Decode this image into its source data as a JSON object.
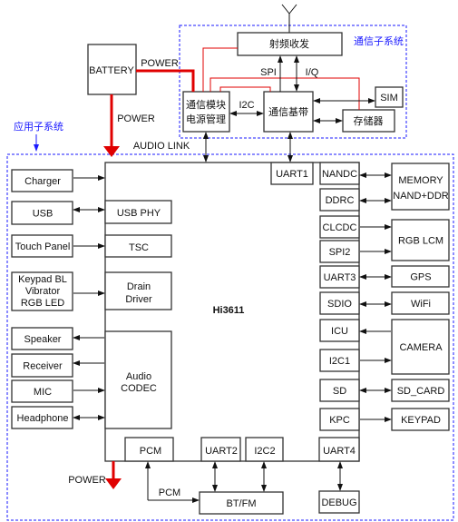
{
  "colors": {
    "power": "#e00000",
    "subsystem_border": "#1a1aff",
    "label": "#1a1aff"
  },
  "comm_subsystem": {
    "title": "通信子系统",
    "rf": "射频收发",
    "pmu": [
      "通信模块",
      "电源管理"
    ],
    "baseband": "通信基带",
    "sim": "SIM",
    "storage": "存储器",
    "spi": "SPI",
    "iq": "I/Q",
    "i2c": "I2C"
  },
  "battery": "BATTERY",
  "power_label": "POWER",
  "audio_link": "AUDIO LINK",
  "app_subsystem": {
    "title": "应用子系统"
  },
  "chip": {
    "name": "Hi3611",
    "left_blocks": [
      "USB PHY",
      "TSC",
      [
        "Drain",
        "Driver"
      ],
      [
        "Audio",
        "CODEC"
      ]
    ],
    "bottom_blocks": [
      "PCM",
      "UART2",
      "I2C2",
      "UART4"
    ],
    "right_blocks": [
      "UART1",
      "NANDC",
      "DDRC",
      "CLCDC",
      "SPI2",
      "UART3",
      "SDIO",
      "ICU",
      "I2C1",
      "SD",
      "KPC"
    ]
  },
  "left_devices": [
    "Charger",
    "USB",
    "Touch Panel",
    [
      "Keypad BL",
      "Vibrator",
      "RGB LED"
    ],
    "Speaker",
    "Receiver",
    "MIC",
    "Headphone"
  ],
  "right_devices": [
    [
      "MEMORY",
      "NAND+DDR"
    ],
    "RGB LCM",
    "GPS",
    "WiFi",
    "CAMERA",
    "SD_CARD",
    "KEYPAD"
  ],
  "bottom_devices": {
    "btfm": "BT/FM",
    "debug": "DEBUG",
    "pcm_label": "PCM"
  }
}
